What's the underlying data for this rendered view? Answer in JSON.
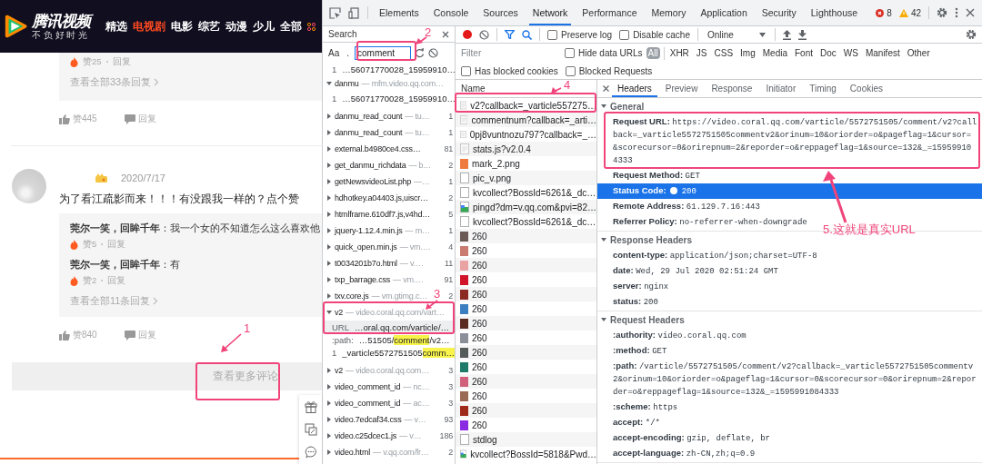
{
  "webpage": {
    "logo": {
      "title": "腾讯视频",
      "slogan": "不 负 好 时 光"
    },
    "nav": [
      {
        "label": "精选",
        "selected": false
      },
      {
        "label": "电视剧",
        "selected": true
      },
      {
        "label": "电影",
        "selected": false
      },
      {
        "label": "综艺",
        "selected": false
      },
      {
        "label": "动漫",
        "selected": false
      },
      {
        "label": "少儿",
        "selected": false
      },
      {
        "label": "全部",
        "selected": false
      }
    ],
    "comments": [
      {
        "replies": [
          {
            "likes": "赞25",
            "reply": "回复"
          }
        ],
        "more_replies": "查看全部33条回复",
        "likes": "赞445",
        "reply": "回复"
      },
      {
        "date": "2020/7/17",
        "text": "为了看江疏影而来！！！有没跟我一样的？点个赞",
        "replies": [
          {
            "text": "**莞尔一笑，回眸千年**：我一个女的不知道怎么这么喜欢他",
            "likes": "赞5",
            "reply": "回复"
          },
          {
            "text": "**莞尔一笑，回眸千年**：有",
            "likes": "赞2",
            "reply": "回复"
          }
        ],
        "more_replies": "查看全部11条回复",
        "likes": "赞840",
        "reply": "回复"
      }
    ],
    "load_more": "查看更多评论"
  },
  "devtools": {
    "tabs": [
      {
        "label": "Elements",
        "selected": false
      },
      {
        "label": "Console",
        "selected": false
      },
      {
        "label": "Sources",
        "selected": false
      },
      {
        "label": "Network",
        "selected": true
      },
      {
        "label": "Performance",
        "selected": false
      },
      {
        "label": "Memory",
        "selected": false
      },
      {
        "label": "Application",
        "selected": false
      },
      {
        "label": "Security",
        "selected": false
      },
      {
        "label": "Lighthouse",
        "selected": false
      }
    ],
    "errors": "8",
    "warnings": "42",
    "search": {
      "title": "Search",
      "match_case": "Aa",
      "regex": ".",
      "query": "comment",
      "results": [
        {
          "kind": "match",
          "label": "1",
          "before": "…56071770028_15959910…",
          "selected": false
        },
        {
          "kind": "file",
          "name": "danmu",
          "host": "— mfm.video.qq.com…",
          "expanded": true,
          "children": [
            {
              "kind": "match",
              "label": "1",
              "before": "…56071770028_15959910…",
              "selected": false
            }
          ]
        },
        {
          "kind": "file",
          "name": "danmu_read_count",
          "host": "— tu…",
          "count": "1",
          "expanded": false
        },
        {
          "kind": "file",
          "name": "danmu_read_count",
          "host": "— tu…",
          "count": "1",
          "expanded": false
        },
        {
          "kind": "file",
          "name": "external.b4980ce4.css…",
          "count": "81",
          "expanded": false
        },
        {
          "kind": "file",
          "name": "get_danmu_richdata",
          "host": "— b…",
          "count": "2",
          "expanded": false
        },
        {
          "kind": "file",
          "name": "getNewsvideoList.php",
          "host": "—…",
          "count": "1",
          "expanded": false
        },
        {
          "kind": "file",
          "name": "hdhotkey.a04403.js,uiscr…",
          "count": "2",
          "expanded": false
        },
        {
          "kind": "file",
          "name": "htmlframe.610df7.js,v4hd…",
          "count": "5",
          "expanded": false
        },
        {
          "kind": "file",
          "name": "jquery-1.12.4.min.js",
          "host": "— m…",
          "count": "1",
          "expanded": false
        },
        {
          "kind": "file",
          "name": "quick_open.min.js",
          "host": "— vm.…",
          "count": "4",
          "expanded": false
        },
        {
          "kind": "file",
          "name": "t0034201b7o.html",
          "host": "— v.…",
          "count": "11",
          "expanded": false
        },
        {
          "kind": "file",
          "name": "txp_barrage.css",
          "host": "— vm.…",
          "count": "91",
          "expanded": false
        },
        {
          "kind": "file",
          "name": "txv.core.js",
          "host": "— vm.gtimg.c…",
          "count": "2",
          "expanded": false
        },
        {
          "kind": "file",
          "name": "v2",
          "host": "— video.coral.qq.com/vart…",
          "expanded": true,
          "children": [
            {
              "kind": "match",
              "label": "URL",
              "before": "…oral.qq.com/varticle/…",
              "selected": true
            },
            {
              "kind": "match",
              "label": ":path:",
              "before": "…51505/",
              "highlight": "comment",
              "after": "/v2…",
              "selected": false
            },
            {
              "kind": "match",
              "label": "1",
              "before": "_varticle5572751505",
              "highlight": "comm…",
              "selected": false
            }
          ]
        },
        {
          "kind": "file",
          "name": "v2",
          "host": "— video.coral.qq.com…",
          "count": "3",
          "expanded": false
        },
        {
          "kind": "file",
          "name": "video_comment_id",
          "host": "— nc…",
          "count": "3",
          "expanded": false
        },
        {
          "kind": "file",
          "name": "video_comment_id",
          "host": "— ac…",
          "count": "3",
          "expanded": false
        },
        {
          "kind": "file",
          "name": "video.7edcaf34.css",
          "host": "— v…",
          "count": "93",
          "expanded": false
        },
        {
          "kind": "file",
          "name": "video.c25dcec1.js",
          "host": "— v…",
          "count": "186",
          "expanded": false
        },
        {
          "kind": "file",
          "name": "video.html",
          "host": "— v.qq.com/fr…",
          "count": "2",
          "expanded": false
        }
      ]
    },
    "network": {
      "recording": true,
      "preserve_log": {
        "label": "Preserve log",
        "checked": false
      },
      "disable_cache": {
        "label": "Disable cache",
        "checked": false
      },
      "throttling": "Online",
      "filter": {
        "placeholder": "Filter"
      },
      "hide_data_urls": {
        "label": "Hide data URLs",
        "checked": false
      },
      "types": [
        {
          "label": "All",
          "selected": true
        },
        {
          "label": "XHR",
          "selected": false
        },
        {
          "label": "JS",
          "selected": false
        },
        {
          "label": "CSS",
          "selected": false
        },
        {
          "label": "Img",
          "selected": false
        },
        {
          "label": "Media",
          "selected": false
        },
        {
          "label": "Font",
          "selected": false
        },
        {
          "label": "Doc",
          "selected": false
        },
        {
          "label": "WS",
          "selected": false
        },
        {
          "label": "Manifest",
          "selected": false
        },
        {
          "label": "Other",
          "selected": false
        }
      ],
      "has_blocked_cookies": {
        "label": "Has blocked cookies",
        "checked": false
      },
      "blocked_requests": {
        "label": "Blocked Requests",
        "checked": false
      },
      "name_column": "Name",
      "requests": [
        {
          "name": "v2?callback=_varticle557275…",
          "kind": "script"
        },
        {
          "name": "commentnum?callback=_arti…",
          "kind": "script"
        },
        {
          "name": "0pj8vuntnozu797?callback=_…",
          "kind": "script"
        },
        {
          "name": "stats.js?v2.0.4",
          "kind": "script"
        },
        {
          "name": "mark_2.png",
          "kind": "thumb",
          "color": "#f07b3f"
        },
        {
          "name": "pic_v.png",
          "kind": "blank"
        },
        {
          "name": "kvcollect?BossId=6261&_dc…",
          "kind": "blank"
        },
        {
          "name": "pingd?dm=v.qq.com&pvi=82…",
          "kind": "picture"
        },
        {
          "name": "kvcollect?BossId=6261&_dc…",
          "kind": "blank"
        },
        {
          "name": "260",
          "kind": "thumb",
          "color": "#6b5a55"
        },
        {
          "name": "260",
          "kind": "thumb",
          "color": "#c87b6e"
        },
        {
          "name": "260",
          "kind": "thumb",
          "color": "#e9a3a3"
        },
        {
          "name": "260",
          "kind": "thumb",
          "color": "#d0142a"
        },
        {
          "name": "260",
          "kind": "thumb",
          "color": "#8a2a22"
        },
        {
          "name": "260",
          "kind": "thumb",
          "color": "#3c7fc0"
        },
        {
          "name": "260",
          "kind": "thumb",
          "color": "#5a2a20"
        },
        {
          "name": "260",
          "kind": "thumb",
          "color": "#8a8f9a"
        },
        {
          "name": "260",
          "kind": "thumb",
          "color": "#555a5a"
        },
        {
          "name": "260",
          "kind": "thumb",
          "color": "#1f7a6a"
        },
        {
          "name": "260",
          "kind": "thumb",
          "color": "#d0607a"
        },
        {
          "name": "260",
          "kind": "thumb",
          "color": "#9a6a55"
        },
        {
          "name": "260",
          "kind": "thumb",
          "color": "#a02a1a"
        },
        {
          "name": "260",
          "kind": "thumb",
          "color": "#8a2be2"
        },
        {
          "name": "stdlog",
          "kind": "blank"
        },
        {
          "name": "kvcollect?BossId=5818&Pwd…",
          "kind": "picture"
        }
      ],
      "detail_tabs": [
        {
          "label": "Headers",
          "selected": true
        },
        {
          "label": "Preview",
          "selected": false
        },
        {
          "label": "Response",
          "selected": false
        },
        {
          "label": "Initiator",
          "selected": false
        },
        {
          "label": "Timing",
          "selected": false
        },
        {
          "label": "Cookies",
          "selected": false
        }
      ],
      "sections": [
        {
          "title": "General",
          "expanded": true,
          "rows": [
            {
              "kind": "text",
              "label": "Request URL:",
              "value_lines": [
                "https://video.coral.qq.com/varticle/5572751505/comment/v2?call",
                "back=_varticle5572751505commentv2&orinum=10&oriorder=o&pageflag=1&cursor=",
                "&scorecursor=0&orirepnum=2&reporder=o&reppageflag=1&source=132&_=15959910",
                "4333"
              ],
              "selected": false
            },
            {
              "kind": "text",
              "label": "Request Method:",
              "value_lines": [
                "GET"
              ],
              "selected": false
            },
            {
              "kind": "status",
              "label": "Status Code:",
              "value_lines": [
                "200"
              ],
              "selected": true
            },
            {
              "kind": "text",
              "label": "Remote Address:",
              "value_lines": [
                "61.129.7.16:443"
              ],
              "selected": false
            },
            {
              "kind": "text",
              "label": "Referrer Policy:",
              "value_lines": [
                "no-referrer-when-downgrade"
              ],
              "selected": false
            }
          ]
        },
        {
          "title": "Response Headers",
          "expanded": true,
          "rows": [
            {
              "kind": "text",
              "label": "content-type:",
              "value_lines": [
                "application/json;charset=UTF-8"
              ],
              "selected": false
            },
            {
              "kind": "text",
              "label": "date:",
              "value_lines": [
                "Wed, 29 Jul 2020 02:51:24 GMT"
              ],
              "selected": false
            },
            {
              "kind": "text",
              "label": "server:",
              "value_lines": [
                "nginx"
              ],
              "selected": false
            },
            {
              "kind": "text",
              "label": "status:",
              "value_lines": [
                "200"
              ],
              "selected": false
            }
          ]
        },
        {
          "title": "Request Headers",
          "expanded": true,
          "rows": [
            {
              "kind": "text",
              "label": ":authority:",
              "value_lines": [
                "video.coral.qq.com"
              ],
              "selected": false
            },
            {
              "kind": "text",
              "label": ":method:",
              "value_lines": [
                "GET"
              ],
              "selected": false
            },
            {
              "kind": "text",
              "label": ":path:",
              "value_lines": [
                "/varticle/5572751505/comment/v2?callback=_varticle5572751505commentv",
                "2&orinum=10&oriorder=o&pageflag=1&cursor=0&scorecursor=0&orirepnum=2&repor",
                "der=o&reppageflag=1&source=132&_=1595991084333"
              ],
              "selected": false
            },
            {
              "kind": "text",
              "label": ":scheme:",
              "value_lines": [
                "https"
              ],
              "selected": false
            },
            {
              "kind": "text",
              "label": "accept:",
              "value_lines": [
                "*/*"
              ],
              "selected": false
            },
            {
              "kind": "text",
              "label": "accept-encoding:",
              "value_lines": [
                "gzip, deflate, br"
              ],
              "selected": false
            },
            {
              "kind": "text",
              "label": "accept-language:",
              "value_lines": [
                "zh-CN,zh;q=0.9"
              ],
              "selected": false
            }
          ]
        }
      ]
    }
  },
  "annotations": [
    {
      "label": "1"
    },
    {
      "label": "2"
    },
    {
      "label": "3"
    },
    {
      "label": "4"
    },
    {
      "label": "5.这就是真实URL"
    }
  ]
}
